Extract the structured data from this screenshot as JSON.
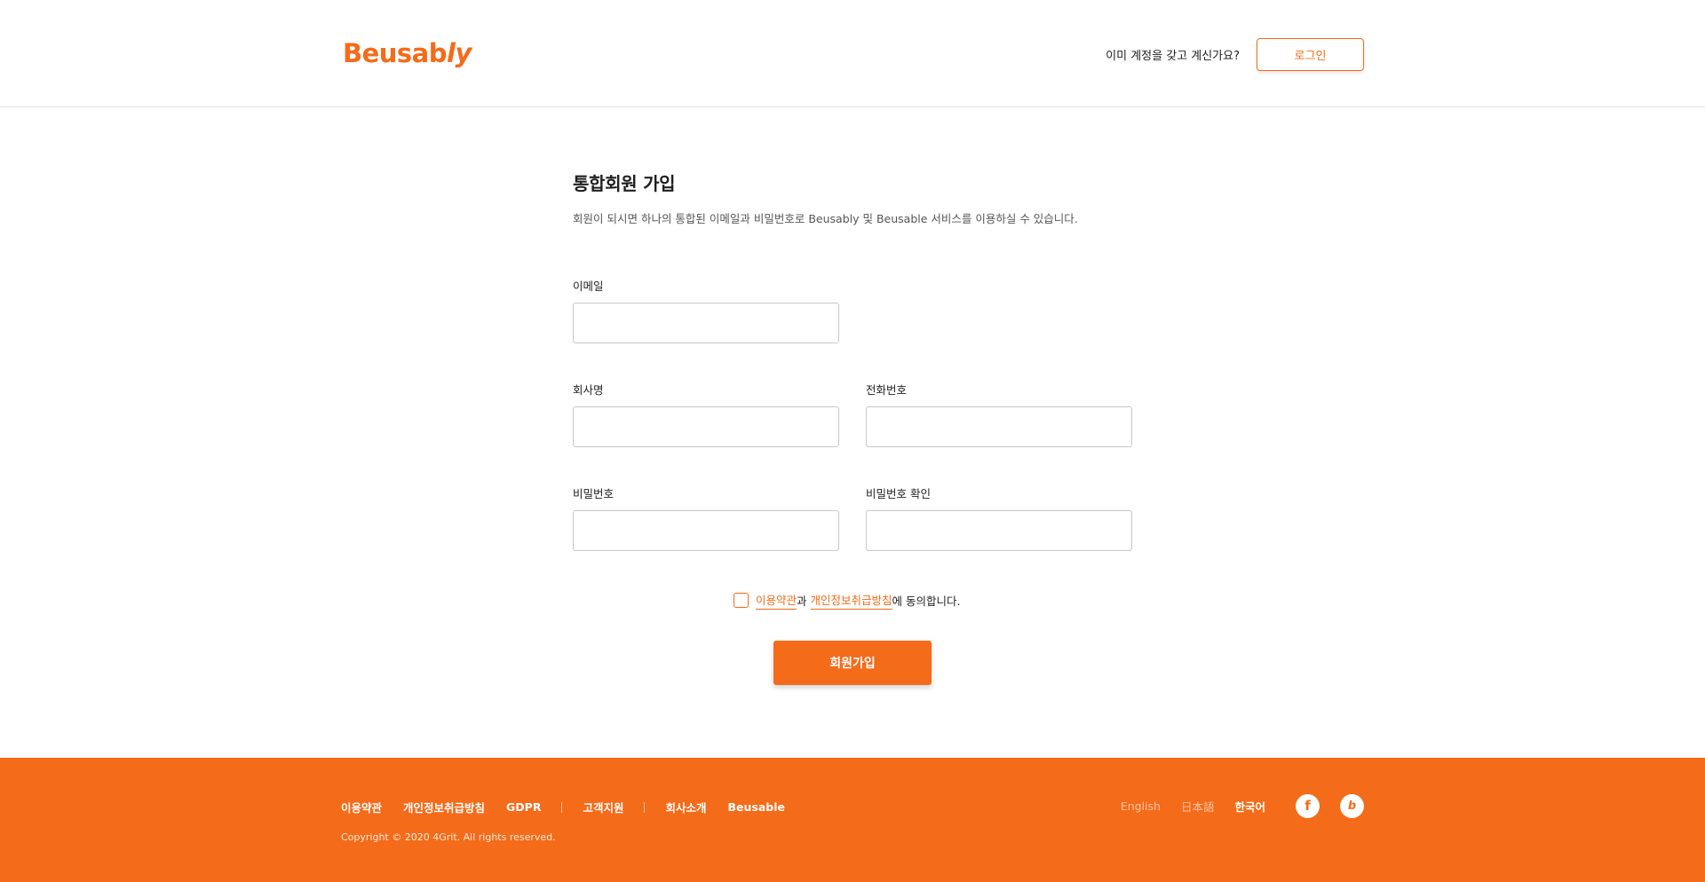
{
  "header": {
    "logo_main": "Beusab",
    "logo_italic": "ly",
    "question": "이미 계정을 갖고 계신가요?",
    "login_label": "로그인"
  },
  "form": {
    "title": "통합회원 가입",
    "subtitle": "회원이 되시면 하나의 통합된 이메일과 비밀번호로 Beusably 및 Beusable 서비스를 이용하실 수 있습니다.",
    "email_label": "이메일",
    "email_value": "",
    "company_label": "회사명",
    "company_value": "",
    "phone_label": "전화번호",
    "phone_value": "",
    "password_label": "비밀번호",
    "password_value": "",
    "password_confirm_label": "비밀번호 확인",
    "password_confirm_value": "",
    "agree_terms_link": "이용약관",
    "agree_and": "과",
    "agree_privacy_link": "개인정보취급방침",
    "agree_suffix": "에 동의합니다.",
    "agree_checked": false,
    "signup_label": "회원가입"
  },
  "footer": {
    "links": [
      "이용약관",
      "개인정보취급방침",
      "GDPR",
      "고객지원",
      "회사소개",
      "Beusable"
    ],
    "copyright": "Copyright © 2020 4Grit. All rights reserved.",
    "languages": [
      "English",
      "日本語",
      "한국어"
    ],
    "active_language": "한국어",
    "facebook_icon": "f",
    "blog_icon": "b"
  },
  "colors": {
    "accent": "#f46b19",
    "text": "#1e1e1e",
    "border": "#c8c8c8"
  }
}
